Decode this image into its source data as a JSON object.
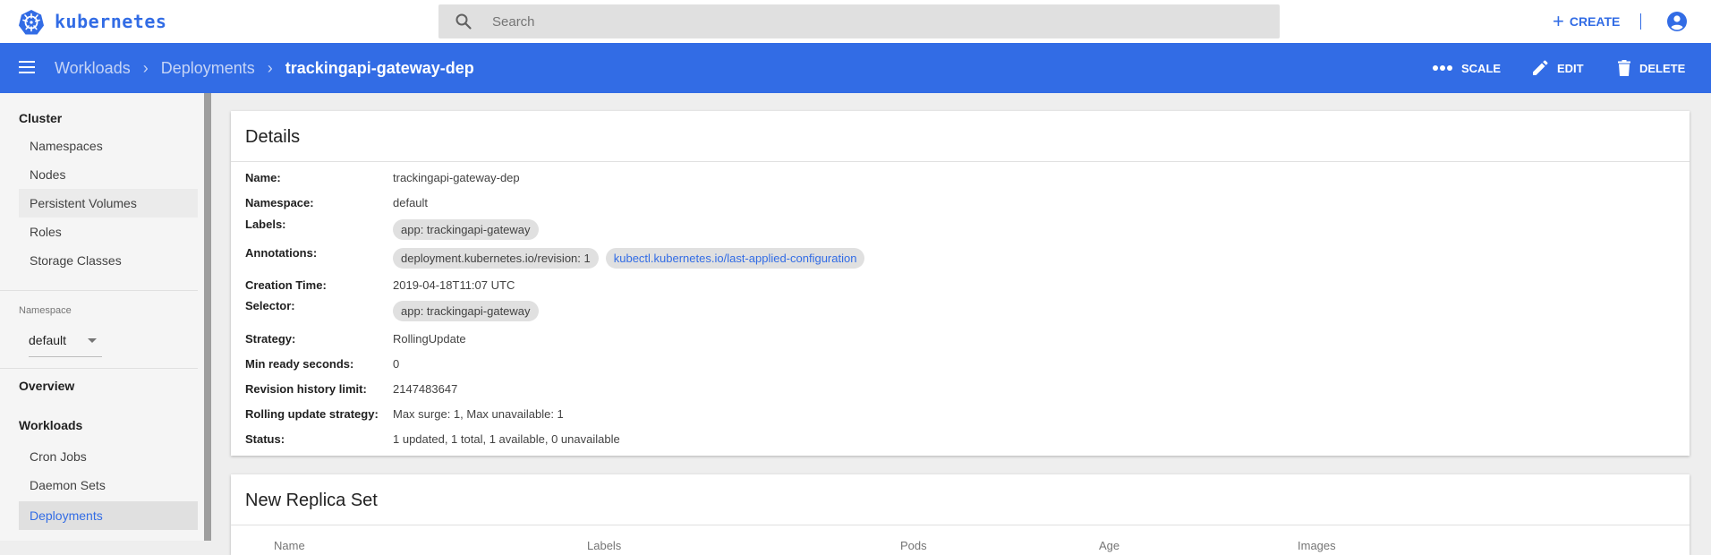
{
  "header": {
    "brand": "kubernetes",
    "search_placeholder": "Search",
    "create_label": "CREATE"
  },
  "toolbar": {
    "breadcrumbs": [
      "Workloads",
      "Deployments"
    ],
    "current": "trackingapi-gateway-dep",
    "scale_label": "SCALE",
    "edit_label": "EDIT",
    "delete_label": "DELETE"
  },
  "sidebar": {
    "cluster_title": "Cluster",
    "cluster_items": [
      "Namespaces",
      "Nodes",
      "Persistent Volumes",
      "Roles",
      "Storage Classes"
    ],
    "namespace_label": "Namespace",
    "namespace_value": "default",
    "overview": "Overview",
    "workloads_title": "Workloads",
    "workload_items": [
      "Cron Jobs",
      "Daemon Sets",
      "Deployments"
    ]
  },
  "details": {
    "title": "Details",
    "name_label": "Name:",
    "name": "trackingapi-gateway-dep",
    "namespace_label": "Namespace:",
    "namespace": "default",
    "labels_label": "Labels:",
    "labels": [
      "app: trackingapi-gateway"
    ],
    "annotations_label": "Annotations:",
    "annotation_revision": "deployment.kubernetes.io/revision:  1",
    "annotation_config": "kubectl.kubernetes.io/last-applied-configuration",
    "creation_label": "Creation Time:",
    "creation_time": "2019-04-18T11:07 UTC",
    "selector_label": "Selector:",
    "selector": "app: trackingapi-gateway",
    "strategy_label": "Strategy:",
    "strategy": "RollingUpdate",
    "min_ready_label": "Min ready seconds:",
    "min_ready": "0",
    "revision_limit_label": "Revision history limit:",
    "revision_limit": "2147483647",
    "rolling_label": "Rolling update strategy:",
    "rolling": "Max surge: 1, Max unavailable: 1",
    "status_label": "Status:",
    "status": "1 updated, 1 total, 1 available, 0 unavailable"
  },
  "replica_set": {
    "title": "New Replica Set",
    "columns": [
      "Name",
      "Labels",
      "Pods",
      "Age",
      "Images"
    ]
  },
  "colors": {
    "primary": "#326ce5",
    "sidebar_bg": "#f5f5f5"
  }
}
